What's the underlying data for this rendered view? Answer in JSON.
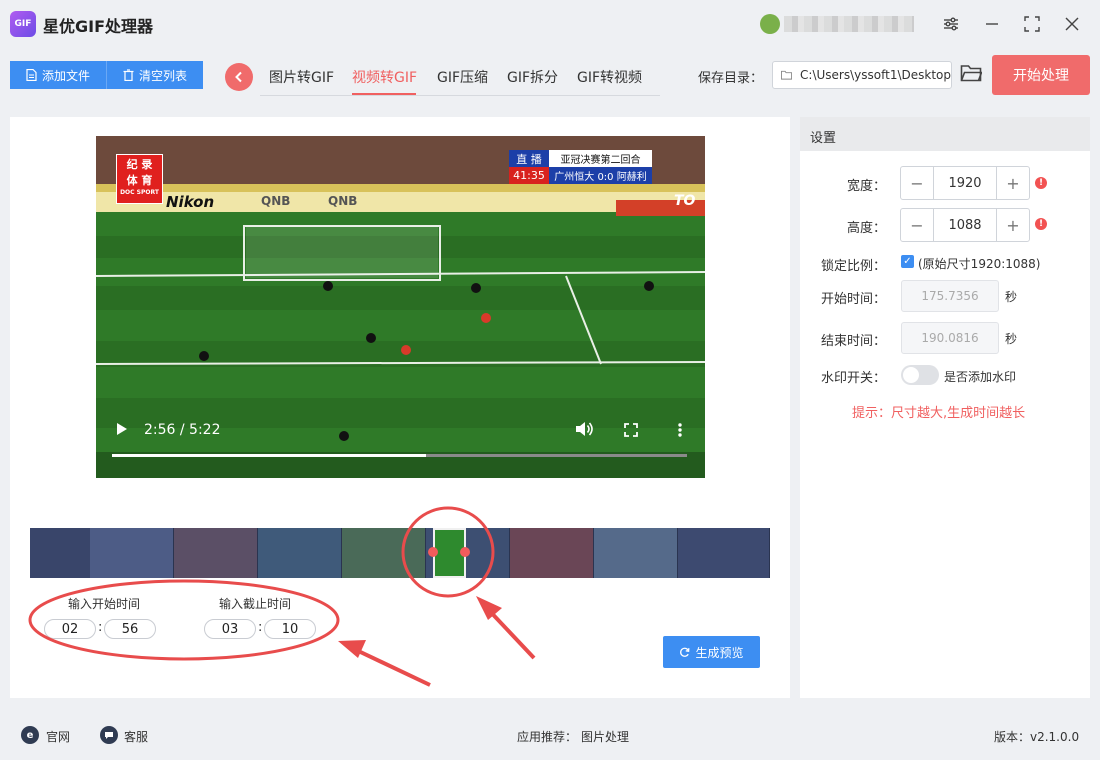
{
  "app": {
    "logo_text": "GIF",
    "title": "星优GIF处理器"
  },
  "window_controls": {
    "settings_icon": "sliders-icon",
    "min_icon": "minimize-icon",
    "max_icon": "maximize-icon",
    "close_icon": "close-icon"
  },
  "toolbar": {
    "add_file": "添加文件",
    "clear_list": "清空列表"
  },
  "tabs": [
    {
      "label": "图片转GIF",
      "active": false
    },
    {
      "label": "视频转GIF",
      "active": true
    },
    {
      "label": "GIF压缩",
      "active": false
    },
    {
      "label": "GIF拆分",
      "active": false
    },
    {
      "label": "GIF转视频",
      "active": false
    }
  ],
  "output": {
    "label": "保存目录：",
    "path": "C:\\Users\\yssoft1\\Desktop",
    "start_button": "开始处理"
  },
  "video": {
    "time_display": "2:56 / 5:22",
    "progress": 0.546,
    "logo_line1": "纪 录",
    "logo_line2": "体 育",
    "logo_sub": "DOC SPORT",
    "live_badge": "直 播",
    "match_title": "亚冠决赛第二回合",
    "match_clock": "41:35",
    "match_score": "广州恒大 0:0 阿赫利",
    "ad_boards": [
      "Nikon",
      "QNB",
      "QNB",
      "TO"
    ]
  },
  "trim": {
    "start_label": "输入开始时间",
    "end_label": "输入截止时间",
    "start_min": "02",
    "start_sec": "56",
    "end_min": "03",
    "end_sec": "10",
    "colon": ":",
    "preview_button": "生成预览"
  },
  "settings": {
    "header": "设置",
    "width_label": "宽度：",
    "width_value": "1920",
    "height_label": "高度：",
    "height_value": "1088",
    "lock_label": "锁定比例：",
    "lock_checked": true,
    "lock_note": "(原始尺寸1920:1088)",
    "start_label": "开始时间：",
    "start_value": "175.7356",
    "end_label": "结束时间：",
    "end_value": "190.0816",
    "unit": "秒",
    "watermark_label": "水印开关：",
    "watermark_note": "是否添加水印",
    "watermark_on": false,
    "tip": "提示：尺寸越大,生成时间越长"
  },
  "status": {
    "website": "官网",
    "support": "客服",
    "recommend_label": "应用推荐：",
    "recommend_value": "图片处理",
    "version": "版本：v2.1.0.0"
  },
  "colors": {
    "accent_blue": "#3d8ef2",
    "accent_red": "#f06b6b",
    "annotation_red": "#e84c4c"
  }
}
